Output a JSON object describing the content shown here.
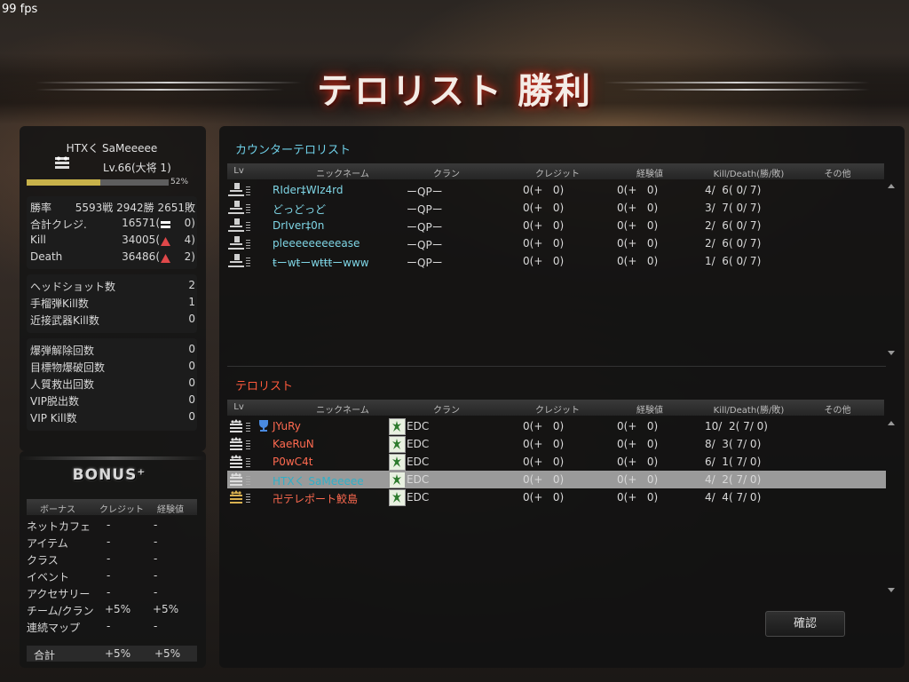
{
  "fps": "99 fps",
  "result_title": "テロリスト 勝利",
  "player": {
    "name": "HTXく SaMeeeee",
    "level": "Lv.66(大将 1)",
    "exp_percent_label": "52%",
    "exp_fraction": 0.52,
    "stats": [
      {
        "label": "勝率",
        "value": "5593戦 2942勝 2651敗"
      },
      {
        "label": "合計クレジ.",
        "value": "16571(",
        "icon": "equals-icon",
        "delta": "0)"
      },
      {
        "label": "Kill",
        "value": "34005(",
        "icon": "up-triangle-icon",
        "delta": "4)"
      },
      {
        "label": "Death",
        "value": "36486(",
        "icon": "up-triangle-icon",
        "delta": "2)"
      }
    ],
    "combat": [
      {
        "label": "ヘッドショット数",
        "value": "2"
      },
      {
        "label": "手榴弾Kill数",
        "value": "1"
      },
      {
        "label": "近接武器Kill数",
        "value": "0"
      }
    ],
    "missions": [
      {
        "label": "爆弾解除回数",
        "value": "0"
      },
      {
        "label": "目標物爆破回数",
        "value": "0"
      },
      {
        "label": "人質救出回数",
        "value": "0"
      },
      {
        "label": "VIP脱出数",
        "value": "0"
      },
      {
        "label": "VIP Kill数",
        "value": "0"
      }
    ]
  },
  "bonus": {
    "title": "BONUS⁺",
    "headers": [
      "ボーナス",
      "クレジット",
      "経験値"
    ],
    "rows": [
      {
        "name": "ネットカフェ",
        "credit": "-",
        "exp": "-"
      },
      {
        "name": "アイテム",
        "credit": "-",
        "exp": "-"
      },
      {
        "name": "クラス",
        "credit": "-",
        "exp": "-"
      },
      {
        "name": "イベント",
        "credit": "-",
        "exp": "-"
      },
      {
        "name": "アクセサリー",
        "credit": "-",
        "exp": "-"
      },
      {
        "name": "チーム/クラン",
        "credit": "+5%",
        "exp": "+5%"
      },
      {
        "name": "連続マップ",
        "credit": "-",
        "exp": "-"
      }
    ],
    "total": {
      "name": "合計",
      "credit": "+5%",
      "exp": "+5%"
    }
  },
  "table_headers": [
    "Lv",
    "ニックネーム",
    "クラン",
    "クレジット",
    "経験値",
    "Kill/Death(勝/敗)",
    "その他"
  ],
  "ct_team": {
    "label": "カウンターテロリスト",
    "name_color": "#7fd6e6",
    "players": [
      {
        "nickname": "RIder‡WIz4rd",
        "clan": "ーQPー",
        "credit": "0(+   0)",
        "exp": "0(+   0)",
        "kd": "4/  6( 0/ 7)"
      },
      {
        "nickname": "どっどっど",
        "clan": "ーQPー",
        "credit": "0(+   0)",
        "exp": "0(+   0)",
        "kd": "3/  7( 0/ 7)"
      },
      {
        "nickname": "DrIver‡0n",
        "clan": "ーQPー",
        "credit": "0(+   0)",
        "exp": "0(+   0)",
        "kd": "2/  6( 0/ 7)"
      },
      {
        "nickname": "pleeeeeeeeease",
        "clan": "ーQPー",
        "credit": "0(+   0)",
        "exp": "0(+   0)",
        "kd": "2/  6( 0/ 7)"
      },
      {
        "nickname": "ŧーwŧーwŧŧŧーwww",
        "clan": "ーQPー",
        "credit": "0(+   0)",
        "exp": "0(+   0)",
        "kd": "1/  6( 0/ 7)"
      }
    ]
  },
  "t_team": {
    "label": "テロリスト",
    "name_color": "#ff6a50",
    "players": [
      {
        "nickname": "JYuRy",
        "clan": "EDC",
        "credit": "0(+   0)",
        "exp": "0(+   0)",
        "kd": "10/  2( 7/ 0)",
        "trophy": true
      },
      {
        "nickname": "KaeRuN",
        "clan": "EDC",
        "credit": "0(+   0)",
        "exp": "0(+   0)",
        "kd": "8/  3( 7/ 0)"
      },
      {
        "nickname": "P0wC4t",
        "clan": "EDC",
        "credit": "0(+   0)",
        "exp": "0(+   0)",
        "kd": "6/  1( 7/ 0)"
      },
      {
        "nickname": "HTXく SaMeeeee",
        "clan": "EDC",
        "credit": "0(+   0)",
        "exp": "0(+   0)",
        "kd": "4/  2( 7/ 0)",
        "self": true
      },
      {
        "nickname": "卍テレポート鮫島",
        "clan": "EDC",
        "credit": "0(+   0)",
        "exp": "0(+   0)",
        "kd": "4/  4( 7/ 0)"
      }
    ]
  },
  "confirm_label": "確認"
}
